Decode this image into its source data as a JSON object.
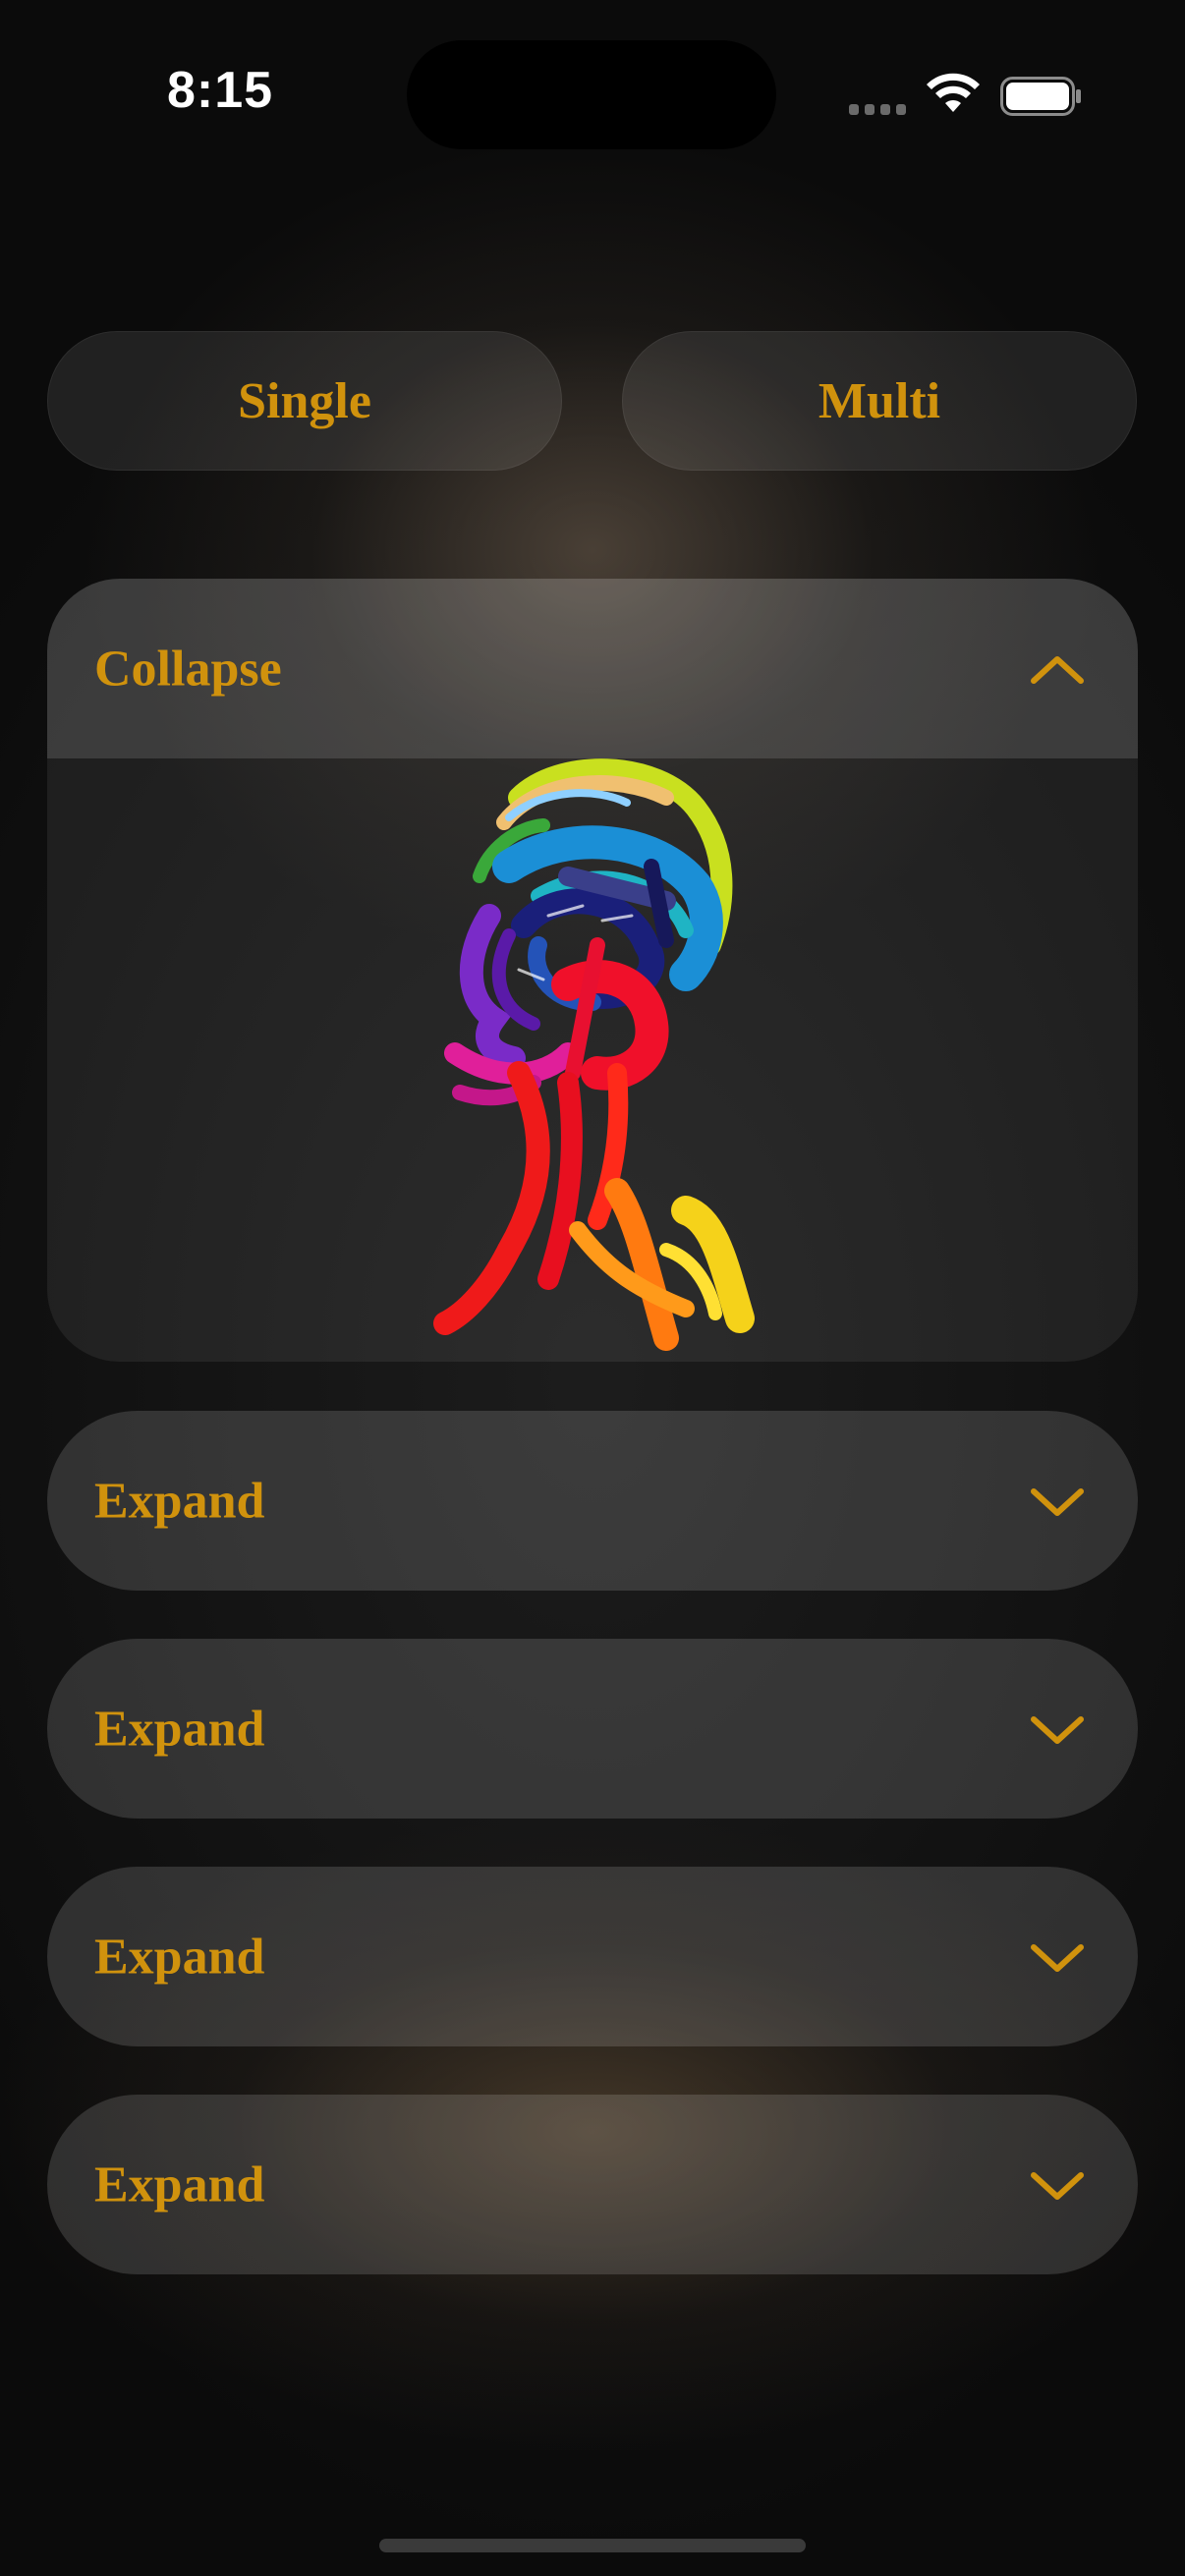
{
  "status_bar": {
    "time": "8:15",
    "signal_icon": "signal-bars-icon",
    "wifi_icon": "wifi-icon",
    "battery_icon": "battery-icon"
  },
  "mode_selector": {
    "single_label": "Single",
    "multi_label": "Multi"
  },
  "accordion": {
    "accent_color": "#d0920d",
    "items": [
      {
        "label": "Collapse",
        "state": "expanded",
        "icon": "chevron-up-icon",
        "content_image": "rainbow-head-sketch"
      },
      {
        "label": "Expand",
        "state": "collapsed",
        "icon": "chevron-down-icon"
      },
      {
        "label": "Expand",
        "state": "collapsed",
        "icon": "chevron-down-icon"
      },
      {
        "label": "Expand",
        "state": "collapsed",
        "icon": "chevron-down-icon"
      },
      {
        "label": "Expand",
        "state": "collapsed",
        "icon": "chevron-down-icon"
      }
    ]
  }
}
